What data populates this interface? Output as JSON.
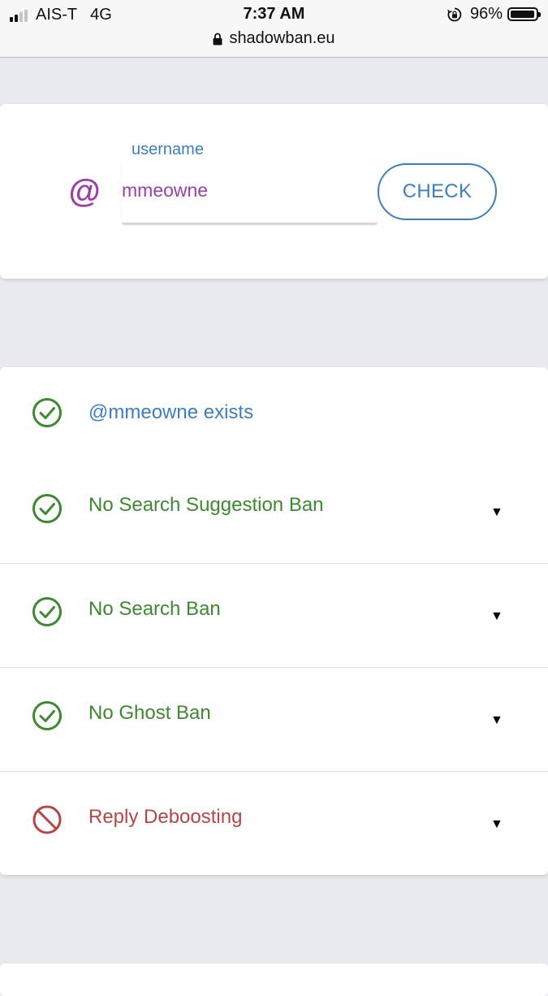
{
  "status_bar": {
    "carrier": "AIS-T",
    "network": "4G",
    "time": "7:37 AM",
    "battery": "96%",
    "battery_level": 0.96,
    "signal_bars": 2,
    "signal_total": 4
  },
  "browser": {
    "url": "shadowban.eu"
  },
  "search": {
    "at_symbol": "@",
    "label": "username",
    "value": "mmeowne",
    "button_label": "CHECK"
  },
  "results": [
    {
      "text": "@mmeowne exists",
      "status": "ok",
      "color": "#3a7fc4",
      "expandable": false
    },
    {
      "text": "No Search Suggestion Ban",
      "status": "ok",
      "color": "#3c8a2e",
      "expandable": true
    },
    {
      "text": "No Search Ban",
      "status": "ok",
      "color": "#3c8a2e",
      "expandable": true
    },
    {
      "text": "No Ghost Ban",
      "status": "ok",
      "color": "#3c8a2e",
      "expandable": true
    },
    {
      "text": "Reply Deboosting",
      "status": "banned",
      "color": "#b84545",
      "expandable": true
    }
  ],
  "colors": {
    "ok_icon": "#3c8a2e",
    "ban_icon": "#b84545",
    "accent_blue": "#3a7fc4",
    "accent_purple": "#9b3fa8"
  },
  "icons": {
    "ok": "check-circle-icon",
    "banned": "prohibited-icon",
    "expand": "triangle-down-icon"
  },
  "caret": "▼"
}
